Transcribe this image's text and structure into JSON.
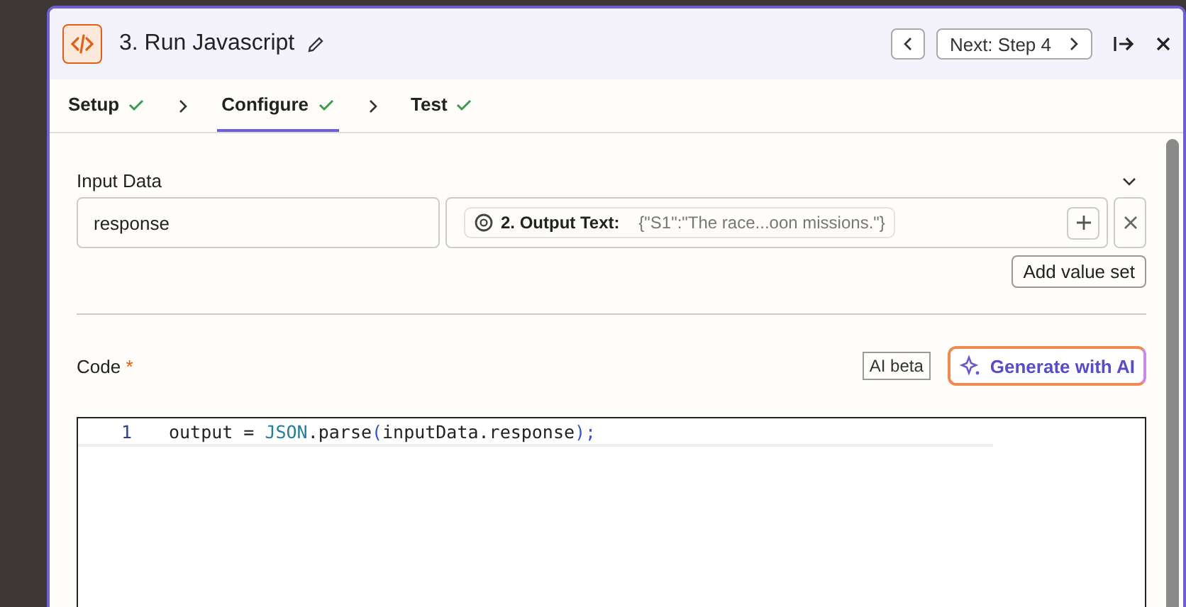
{
  "header": {
    "title": "3. Run Javascript",
    "next_label": "Next: Step 4"
  },
  "steps": [
    {
      "label": "Setup",
      "done": true,
      "selected": false
    },
    {
      "label": "Configure",
      "done": true,
      "selected": true
    },
    {
      "label": "Test",
      "done": true,
      "selected": false
    }
  ],
  "input_data": {
    "label": "Input Data",
    "key": "response",
    "value_source": "2. Output Text:",
    "value_text": "{\"S1\":\"The race...oon missions.\"}",
    "add_button": "Add value set"
  },
  "code": {
    "label": "Code",
    "required_mark": "*",
    "ai_badge": "AI beta",
    "generate_button": "Generate with AI",
    "lines": [
      {
        "number": "1",
        "tokens": [
          {
            "text": "output = ",
            "kind": "plain"
          },
          {
            "text": "JSON",
            "kind": "builtin"
          },
          {
            "text": ".parse",
            "kind": "plain"
          },
          {
            "text": "(",
            "kind": "paren"
          },
          {
            "text": "inputData.response",
            "kind": "plain"
          },
          {
            "text": ");",
            "kind": "paren"
          }
        ]
      }
    ]
  }
}
